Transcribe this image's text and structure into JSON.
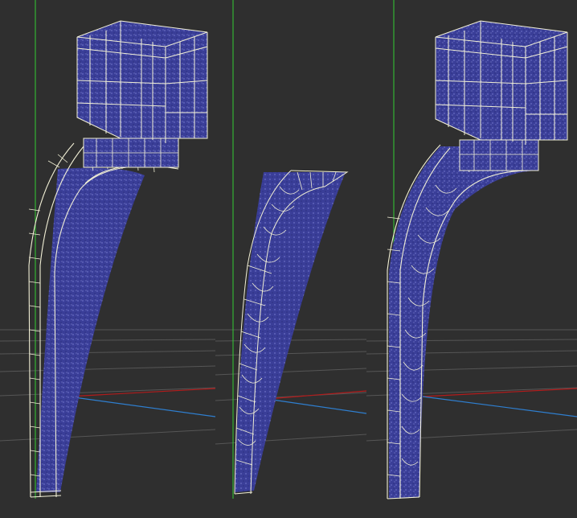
{
  "scene": {
    "background_color": "#2f2f2f",
    "grid_color": "#5a5a5a",
    "axis_colors": {
      "x": "#b31b1b",
      "y": "#2f7fd0",
      "z": "#33cc33"
    },
    "wire_color": "#f2f0d6",
    "surface_color": "#3b3f9a"
  },
  "viewports": [
    {
      "id": "left",
      "model": "corbel-solid-wireframe"
    },
    {
      "id": "middle",
      "model": "corbel-curved-panel"
    },
    {
      "id": "right",
      "model": "corbel-wireframe-shaded"
    }
  ]
}
